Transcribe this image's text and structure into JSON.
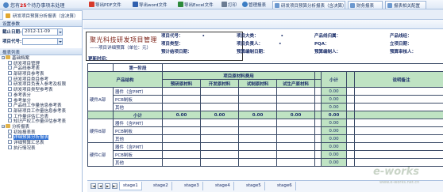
{
  "notice": {
    "prefix": "您有",
    "count": "25",
    "suffix": "个待办事项未处理"
  },
  "top_tabs": [
    {
      "label": "研发项目预算分析报表（含决算）"
    },
    {
      "label": "财务报表"
    },
    {
      "label": "报表相关配置"
    }
  ],
  "doc_tab": "研发项目预算分析报表（含决算）",
  "left": {
    "settings_title": "设置参数",
    "deadline_label": "截止日期:",
    "deadline_value": "2012-11-09",
    "project_label": "项目代号:",
    "report_list_title": "报表列表",
    "tree": [
      {
        "level": 0,
        "type": "folder",
        "label": "基础档案"
      },
      {
        "level": 1,
        "type": "doc",
        "label": "研发项目管理"
      },
      {
        "level": 1,
        "type": "doc",
        "label": "产品线参考表"
      },
      {
        "level": 1,
        "type": "doc",
        "label": "部研项目参考表"
      },
      {
        "level": 1,
        "type": "doc",
        "label": "研发项目类目参考"
      },
      {
        "level": 1,
        "type": "doc",
        "label": "研发项目负责人参考及权限"
      },
      {
        "level": 1,
        "type": "doc",
        "label": "研发项目类型参考表"
      },
      {
        "level": 1,
        "type": "doc",
        "label": "参考表分"
      },
      {
        "level": 1,
        "type": "doc",
        "label": "参考单分"
      },
      {
        "level": 1,
        "type": "doc",
        "label": "产品线工作量信息参考表"
      },
      {
        "level": 1,
        "type": "doc",
        "label": "部研项目工作量信息参考表"
      },
      {
        "level": 1,
        "type": "doc",
        "label": "工作量评估汇总表"
      },
      {
        "level": 1,
        "type": "doc",
        "label": "知识产权工作量评估参考表"
      },
      {
        "level": 0,
        "type": "folder",
        "label": "分析报表"
      },
      {
        "level": 1,
        "type": "doc",
        "label": "初始报表表"
      },
      {
        "level": 1,
        "type": "doc",
        "label": "详细预算分析报表",
        "selected": true
      },
      {
        "level": 1,
        "type": "doc",
        "label": "详细预算汇总表"
      },
      {
        "level": 1,
        "type": "doc",
        "label": "执行情况表"
      }
    ]
  },
  "toolbar": [
    {
      "label": "导出PDF文件",
      "color": "#d63a2c"
    },
    {
      "label": "导出word文件",
      "color": "#2f5fae"
    },
    {
      "label": "导出Excel文件",
      "color": "#2d8a3b"
    },
    {
      "label": "打印",
      "color": "#6b7c93"
    },
    {
      "label": "管理报表",
      "color": "#3b7dc4"
    }
  ],
  "header": {
    "company": "聚光科技研发项目管理",
    "subtitle": "——项目详细预算（单位：元）",
    "update_time": "更新时间：",
    "fields": [
      {
        "label": "项目代号：",
        "value": "•"
      },
      {
        "label": "项目类型：",
        "value": ""
      },
      {
        "label": "预计结项日期：",
        "value": ""
      },
      {
        "label": "项目大类：",
        "value": "•"
      },
      {
        "label": "项目负责人：",
        "value": "•"
      },
      {
        "label": "预算编制日期：",
        "value": ""
      },
      {
        "label": "产品线归属：",
        "value": ""
      },
      {
        "label": "PQA：",
        "value": ""
      },
      {
        "label": "预算编制人：",
        "value": ""
      },
      {
        "label": "产品线经：",
        "value": ""
      },
      {
        "label": "立项日期：",
        "value": ""
      },
      {
        "label": "预算审核人：",
        "value": ""
      }
    ]
  },
  "grid": {
    "stage_title": "第一阶段",
    "col_product": "产品结构",
    "col_group": "项目原材料费用",
    "cols": [
      "预研原材料",
      "开发原材料",
      "试制原材料",
      "试生产原材料"
    ],
    "col_subtotal": "小计",
    "col_note": "说明备注",
    "sections": [
      {
        "name": "硬件A部",
        "rows": [
          {
            "label": "器件（含PMT）",
            "sub": "0.00"
          },
          {
            "label": "PCB制板",
            "sub": "0.00"
          },
          {
            "label": "其他",
            "sub": "0.00"
          }
        ]
      },
      {
        "name": "硬件B部",
        "rows": [
          {
            "label": "器件（含PMT）",
            "sub": "0.00"
          },
          {
            "label": "PCB制板",
            "sub": "0.00"
          },
          {
            "label": "其他",
            "sub": "0.00"
          }
        ]
      },
      {
        "name": "硬件C部",
        "rows": [
          {
            "label": "器件（含PMT）",
            "sub": "0.00"
          },
          {
            "label": "PCB制板",
            "sub": "0.00"
          },
          {
            "label": "其他",
            "sub": "0.00"
          }
        ]
      }
    ],
    "subtotal_label": "小计",
    "subtotal_values": [
      "0.00",
      "0.00",
      "0.00",
      "0.00",
      "0.00"
    ]
  },
  "sheet_tabs": [
    "stage1",
    "stage2",
    "stage3",
    "stage4",
    "stage5",
    "stage6"
  ],
  "watermark": {
    "brand": "e-works",
    "sub": "www.e-works.net.cn"
  }
}
